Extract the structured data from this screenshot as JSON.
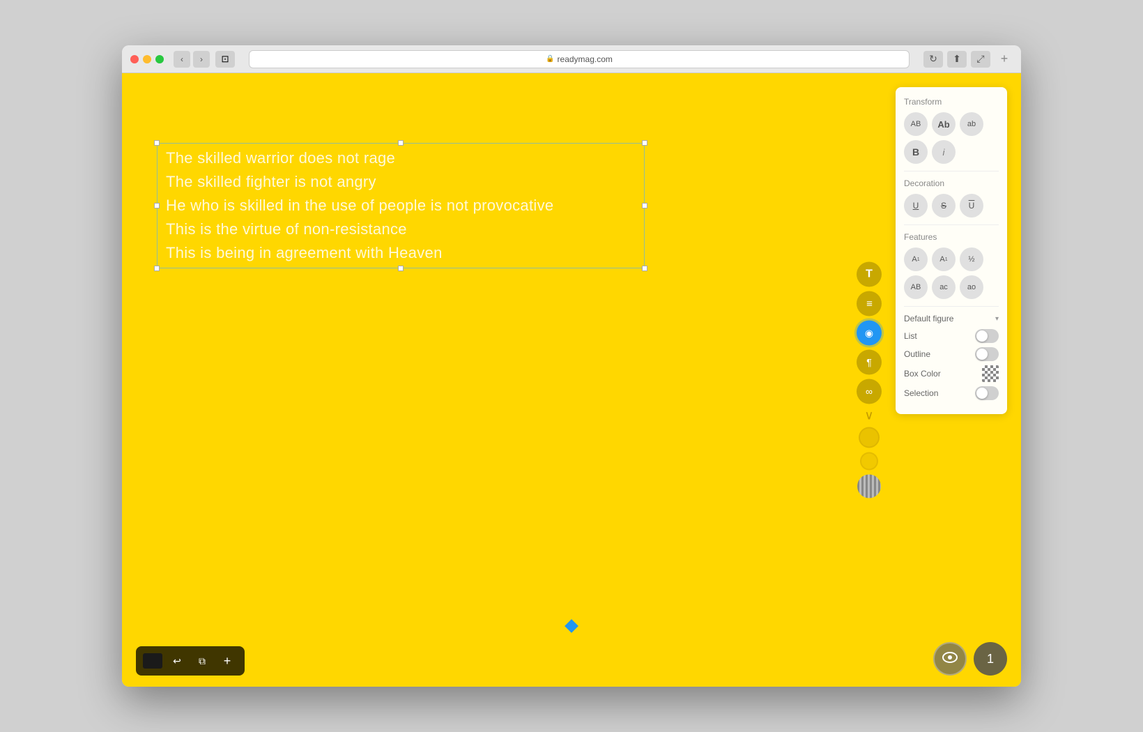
{
  "browser": {
    "url": "readymag.com",
    "back_label": "‹",
    "forward_label": "›",
    "sidebar_icon": "⊡",
    "reload_icon": "↻",
    "share_icon": "⬆",
    "fullscreen_icon": "⤢",
    "plus_icon": "+"
  },
  "canvas": {
    "background_color": "#ffd700",
    "text_lines": [
      "The skilled warrior does not rage",
      "The skilled fighter is not angry",
      "He who is skilled in the use of people is not provocative",
      "This is the virtue of non-resistance",
      "This is being in agreement with Heaven"
    ]
  },
  "right_panel": {
    "transform_label": "Transform",
    "btn_AB_upper": "AB",
    "btn_Ab_title": "Ab",
    "btn_ab_lower": "ab",
    "btn_bold": "B",
    "btn_italic": "i",
    "decoration_label": "Decoration",
    "btn_underline": "U̲",
    "btn_strikethrough": "S̶",
    "btn_overline": "Ū",
    "features_label": "Features",
    "btn_superscript": "A¹",
    "btn_subscript": "A₁",
    "btn_fraction": "½",
    "btn_caps": "AB",
    "btn_smallcaps": "ac",
    "btn_oldstyle": "ao",
    "default_figure_label": "Default figure",
    "list_label": "List",
    "outline_label": "Outline",
    "box_color_label": "Box Color",
    "selection_label": "Selection"
  },
  "side_toolbar": {
    "text_icon": "T",
    "align_icon": "≡",
    "bullet_icon": "◉",
    "paragraph_icon": "¶",
    "link_icon": "∞",
    "circle1": "",
    "circle2": "",
    "striped": ""
  },
  "bottom_toolbar": {
    "add_label": "+",
    "layers_label": "⧉",
    "return_label": "↩"
  },
  "bottom_right": {
    "preview_icon": "👁",
    "page_number": "1"
  }
}
